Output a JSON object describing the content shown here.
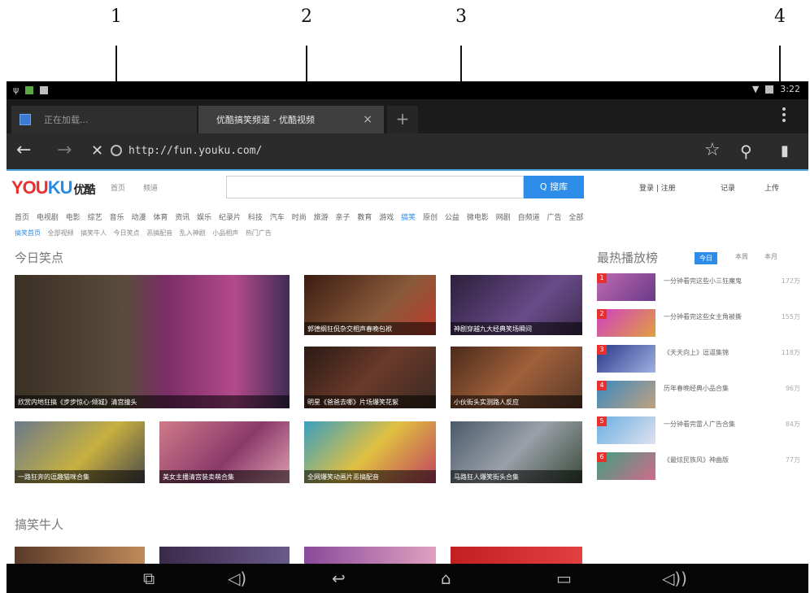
{
  "callouts": [
    "1",
    "2",
    "3",
    "4"
  ],
  "statusbar": {
    "time": "3:22"
  },
  "tabs": [
    {
      "title": "正在加载..."
    },
    {
      "title": "优酷搞笑频道 - 优酷视频",
      "close": "×"
    }
  ],
  "new_tab_label": "+",
  "addressbar": {
    "back": "←",
    "forward": "→",
    "stop": "✕",
    "url": "http://fun.youku.com/",
    "star": "☆",
    "search": "⚲",
    "bookmark": "▮"
  },
  "site": {
    "logo_en_1": "YOU",
    "logo_en_2": "KU",
    "logo_cn": "优酷",
    "header_links": [
      "首页",
      "频道"
    ],
    "search_button": "Q 搜库",
    "right_links": [
      "登录 | 注册",
      "记录",
      "上传"
    ],
    "nav": [
      "首页",
      "电视剧",
      "电影",
      "综艺",
      "音乐",
      "动漫",
      "体育",
      "资讯",
      "娱乐",
      "纪录片",
      "科技",
      "汽车",
      "时尚",
      "旅游",
      "亲子",
      "教育",
      "游戏",
      "搞笑",
      "原创",
      "公益",
      "微电影",
      "网剧",
      "自频道",
      "广告",
      "全部"
    ],
    "nav_active": "搞笑",
    "sub_nav": [
      "搞笑首页",
      "全部视频",
      "搞笑牛人",
      "今日笑点",
      "恶搞配音",
      "乱入神剧",
      "小品相声",
      "热门广告"
    ],
    "sub_nav_active": "搞笑首页",
    "section_1": "今日笑点",
    "section_2": "搞笑牛人",
    "rank_title": "最热播放榜",
    "rank_tabs": [
      "今日",
      "本周",
      "本月"
    ],
    "featured": [
      {
        "caption": "欣赏内地狂搞《步步惊心·倾城》清宫撞头"
      },
      {
        "caption": "郭德纲狂侃杂交相声春晚包袱"
      },
      {
        "caption": "神剧穿越九大经典笑场瞬间"
      },
      {
        "caption": "明星《爸爸去哪》片场爆笑花絮"
      },
      {
        "caption": "小伙街头实测路人反应"
      },
      {
        "caption": "一路狂奔的逗趣猫咪合集"
      },
      {
        "caption": "美女主播清宫装卖萌合集"
      },
      {
        "caption": "全网爆笑动画片恶搞配音"
      },
      {
        "caption": "马路狂人爆笑街头合集"
      }
    ],
    "ranking": [
      {
        "num": "1",
        "text": "一分钟看完这些小三狂魔鬼",
        "count": "172万"
      },
      {
        "num": "2",
        "text": "一分钟看完这些女主角被撕",
        "count": "155万"
      },
      {
        "num": "3",
        "text": "《天天向上》逗逼集锦",
        "count": "118万"
      },
      {
        "num": "4",
        "text": "历年春晚经典小品合集",
        "count": "96万"
      },
      {
        "num": "5",
        "text": "一分钟看完雷人广告合集",
        "count": "84万"
      },
      {
        "num": "6",
        "text": "《最炫民族风》神曲版",
        "count": "77万"
      }
    ]
  },
  "navbar": [
    "⧉",
    "◁)",
    "↩",
    "⌂",
    "▭",
    "◁))"
  ]
}
